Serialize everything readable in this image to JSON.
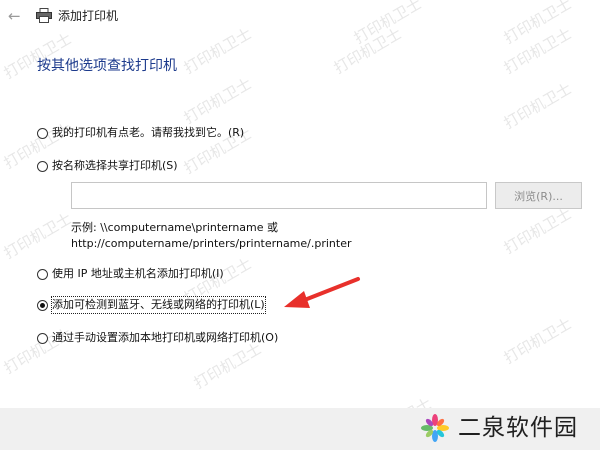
{
  "window": {
    "back_icon": "back-arrow-icon",
    "printer_icon": "printer-icon",
    "title": "添加打印机"
  },
  "main": {
    "heading": "按其他选项查找打印机",
    "options": [
      {
        "label": "我的打印机有点老。请帮我找到它。(R)",
        "checked": false
      },
      {
        "label": "按名称选择共享打印机(S)",
        "checked": false
      },
      {
        "label": "使用 IP 地址或主机名添加打印机(I)",
        "checked": false
      },
      {
        "label": "添加可检测到蓝牙、无线或网络的打印机(L)",
        "checked": true
      },
      {
        "label": "通过手动设置添加本地打印机或网络打印机(O)",
        "checked": false
      }
    ],
    "share_input_value": "",
    "browse_label": "浏览(R)...",
    "example_line1": "示例: \\\\computername\\printername 或",
    "example_line2": "http://computername/printers/printername/.printer"
  },
  "watermark_text": "打印机卫士",
  "logo_text": "二泉软件园",
  "colors": {
    "heading": "#1c3a8c",
    "arrow": "#e8302b",
    "bottom_bar": "#f0f0f0"
  }
}
